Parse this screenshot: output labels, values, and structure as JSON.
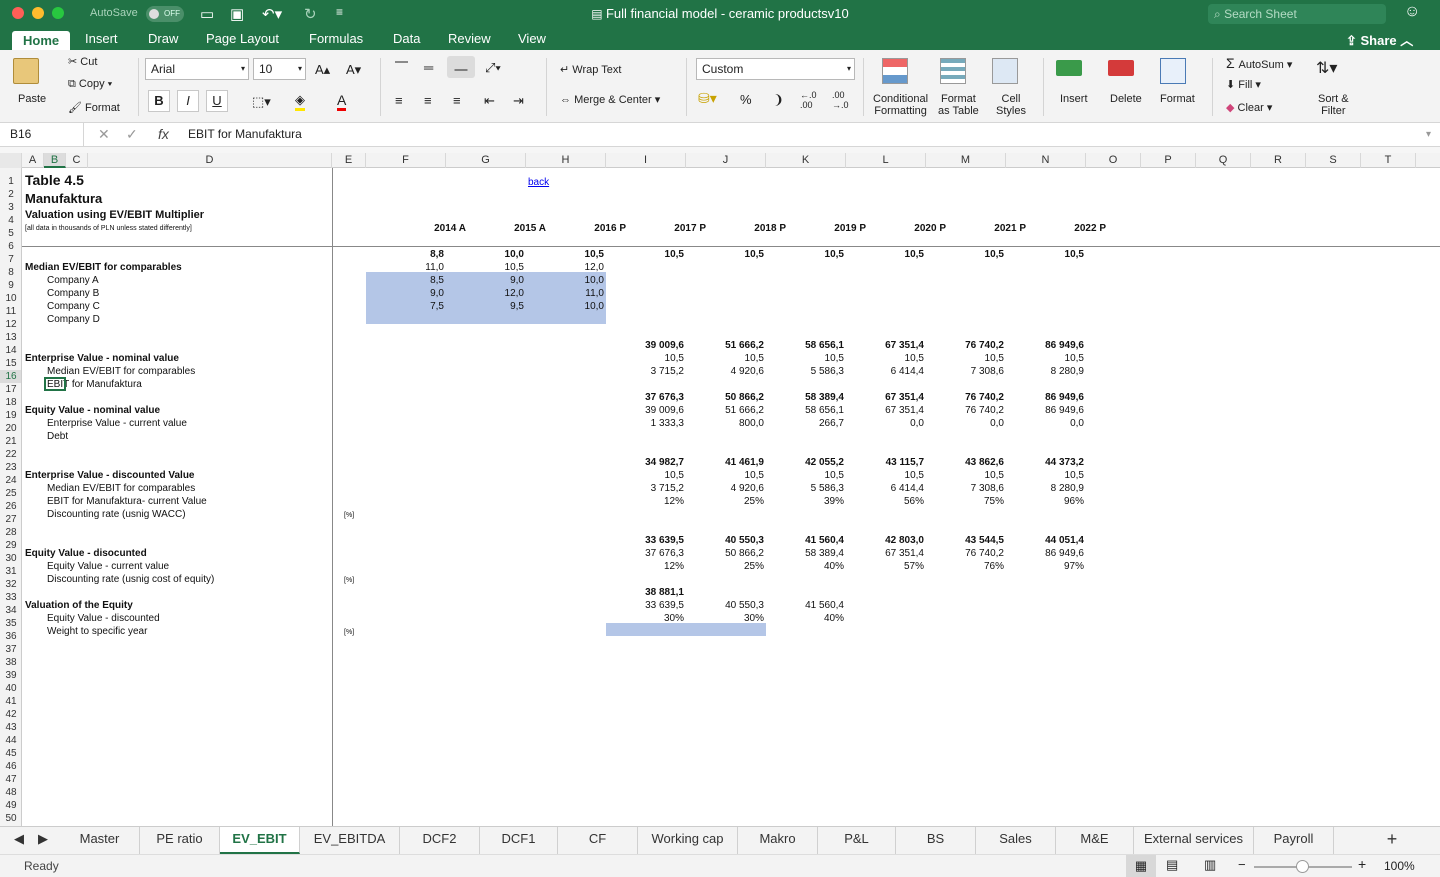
{
  "window": {
    "autosave_label": "AutoSave",
    "autosave_state": "OFF",
    "title": "Full financial model - ceramic productsv10",
    "search_placeholder": "Search Sheet"
  },
  "ribbon_tabs": [
    "Home",
    "Insert",
    "Draw",
    "Page Layout",
    "Formulas",
    "Data",
    "Review",
    "View"
  ],
  "share_label": "Share",
  "ribbon": {
    "paste": "Paste",
    "cut": "Cut",
    "copy": "Copy",
    "format_painter": "Format",
    "font_name": "Arial",
    "font_size": "10",
    "bold": "B",
    "italic": "I",
    "underline": "U",
    "wrap_text": "Wrap Text",
    "merge_center": "Merge & Center",
    "number_format": "Custom",
    "percent": "%",
    "comma": "❩",
    "conditional_formatting": [
      "Conditional",
      "Formatting"
    ],
    "format_as_table": [
      "Format",
      "as Table"
    ],
    "cell_styles": [
      "Cell",
      "Styles"
    ],
    "insert": "Insert",
    "delete": "Delete",
    "format": "Format",
    "autosum": "AutoSum",
    "fill": "Fill",
    "clear": "Clear",
    "sort_filter": [
      "Sort &",
      "Filter"
    ]
  },
  "formula_bar": {
    "name_box": "B16",
    "fx": "fx",
    "formula": "EBIT for Manufaktura"
  },
  "columns": [
    "A",
    "B",
    "C",
    "D",
    "E",
    "F",
    "G",
    "H",
    "I",
    "J",
    "K",
    "L",
    "M",
    "N",
    "O",
    "P",
    "Q",
    "R",
    "S",
    "T"
  ],
  "rows": [
    "1",
    "2",
    "3",
    "4",
    "5",
    "6",
    "7",
    "8",
    "9",
    "10",
    "11",
    "12",
    "13",
    "14",
    "15",
    "16",
    "17",
    "18",
    "19",
    "20",
    "21",
    "22",
    "23",
    "24",
    "25",
    "26",
    "27",
    "28",
    "29",
    "30",
    "31",
    "32",
    "33",
    "34",
    "35",
    "36",
    "37",
    "38",
    "39",
    "40",
    "41",
    "42",
    "43",
    "44",
    "45",
    "46",
    "47",
    "48",
    "49",
    "50"
  ],
  "sheet": {
    "title": "Table 4.5",
    "company": "Manufaktura",
    "subtitle": "Valuation using EV/EBIT Multiplier",
    "note": "[all data in thousands of PLN unless stated differently]",
    "back_link": "back",
    "years": [
      "2014 A",
      "2015 A",
      "2016 P",
      "2017 P",
      "2018 P",
      "2019 P",
      "2020 P",
      "2021 P",
      "2022 P"
    ],
    "labels": {
      "median": "Median EV/EBIT for comparables",
      "company_a": "Company A",
      "company_b": "Company B",
      "company_c": "Company C",
      "company_d": "Company D",
      "ev_nominal": "Enterprise Value - nominal value",
      "ev_median": "Median EV/EBIT for comparables",
      "ev_ebit": "EBIT for Manufaktura",
      "eq_nominal": "Equity Value - nominal value",
      "eq_ev": "Enterprise Value - current value",
      "eq_debt": "Debt",
      "evd": "Enterprise Value - discounted Value",
      "evd_median": "Median EV/EBIT for comparables",
      "evd_ebit": "EBIT for Manufaktura- current Value",
      "evd_rate": "Discounting rate (usnig WACC)",
      "eqd": "Equity Value - disocunted",
      "eqd_eq": "Equity Value - current value",
      "eqd_rate": "Discounting rate (usnig cost of equity)",
      "val": "Valuation of the Equity",
      "val_eqd": "Equity Value - discounted",
      "val_weight": "Weight to specific year",
      "pct": "[%]"
    },
    "median_row": [
      "8,8",
      "10,0",
      "10,5",
      "10,5",
      "10,5",
      "10,5",
      "10,5",
      "10,5",
      "10,5"
    ],
    "company_a": [
      "11,0",
      "10,5",
      "12,0"
    ],
    "company_b": [
      "8,5",
      "9,0",
      "10,0"
    ],
    "company_c": [
      "9,0",
      "12,0",
      "11,0"
    ],
    "company_d": [
      "7,5",
      "9,5",
      "10,0"
    ],
    "ev_nominal": [
      "39 009,6",
      "51 666,2",
      "58 656,1",
      "67 351,4",
      "76 740,2",
      "86 949,6"
    ],
    "ev_median": [
      "10,5",
      "10,5",
      "10,5",
      "10,5",
      "10,5",
      "10,5"
    ],
    "ev_ebit": [
      "3 715,2",
      "4 920,6",
      "5 586,3",
      "6 414,4",
      "7 308,6",
      "8 280,9"
    ],
    "eq_nominal": [
      "37 676,3",
      "50 866,2",
      "58 389,4",
      "67 351,4",
      "76 740,2",
      "86 949,6"
    ],
    "eq_ev": [
      "39 009,6",
      "51 666,2",
      "58 656,1",
      "67 351,4",
      "76 740,2",
      "86 949,6"
    ],
    "eq_debt": [
      "1 333,3",
      "800,0",
      "266,7",
      "0,0",
      "0,0",
      "0,0"
    ],
    "evd": [
      "34 982,7",
      "41 461,9",
      "42 055,2",
      "43 115,7",
      "43 862,6",
      "44 373,2"
    ],
    "evd_median": [
      "10,5",
      "10,5",
      "10,5",
      "10,5",
      "10,5",
      "10,5"
    ],
    "evd_ebit": [
      "3 715,2",
      "4 920,6",
      "5 586,3",
      "6 414,4",
      "7 308,6",
      "8 280,9"
    ],
    "evd_rate": [
      "12%",
      "25%",
      "39%",
      "56%",
      "75%",
      "96%"
    ],
    "eqd": [
      "33 639,5",
      "40 550,3",
      "41 560,4",
      "42 803,0",
      "43 544,5",
      "44 051,4"
    ],
    "eqd_eq": [
      "37 676,3",
      "50 866,2",
      "58 389,4",
      "67 351,4",
      "76 740,2",
      "86 949,6"
    ],
    "eqd_rate": [
      "12%",
      "25%",
      "40%",
      "57%",
      "76%",
      "97%"
    ],
    "val": [
      "38 881,1"
    ],
    "val_eqd": [
      "33 639,5",
      "40 550,3",
      "41 560,4"
    ],
    "val_weight": [
      "30%",
      "30%",
      "40%"
    ]
  },
  "sheet_tabs": [
    "Master",
    "PE ratio",
    "EV_EBIT",
    "EV_EBITDA",
    "DCF2",
    "DCF1",
    "CF",
    "Working cap",
    "Makro",
    "P&L",
    "BS",
    "Sales",
    "M&E",
    "External services",
    "Payroll"
  ],
  "active_sheet": "EV_EBIT",
  "status": {
    "ready": "Ready",
    "zoom": "100%"
  },
  "colors": {
    "excel_green": "#217346",
    "highlight": "#b4c6e7"
  }
}
